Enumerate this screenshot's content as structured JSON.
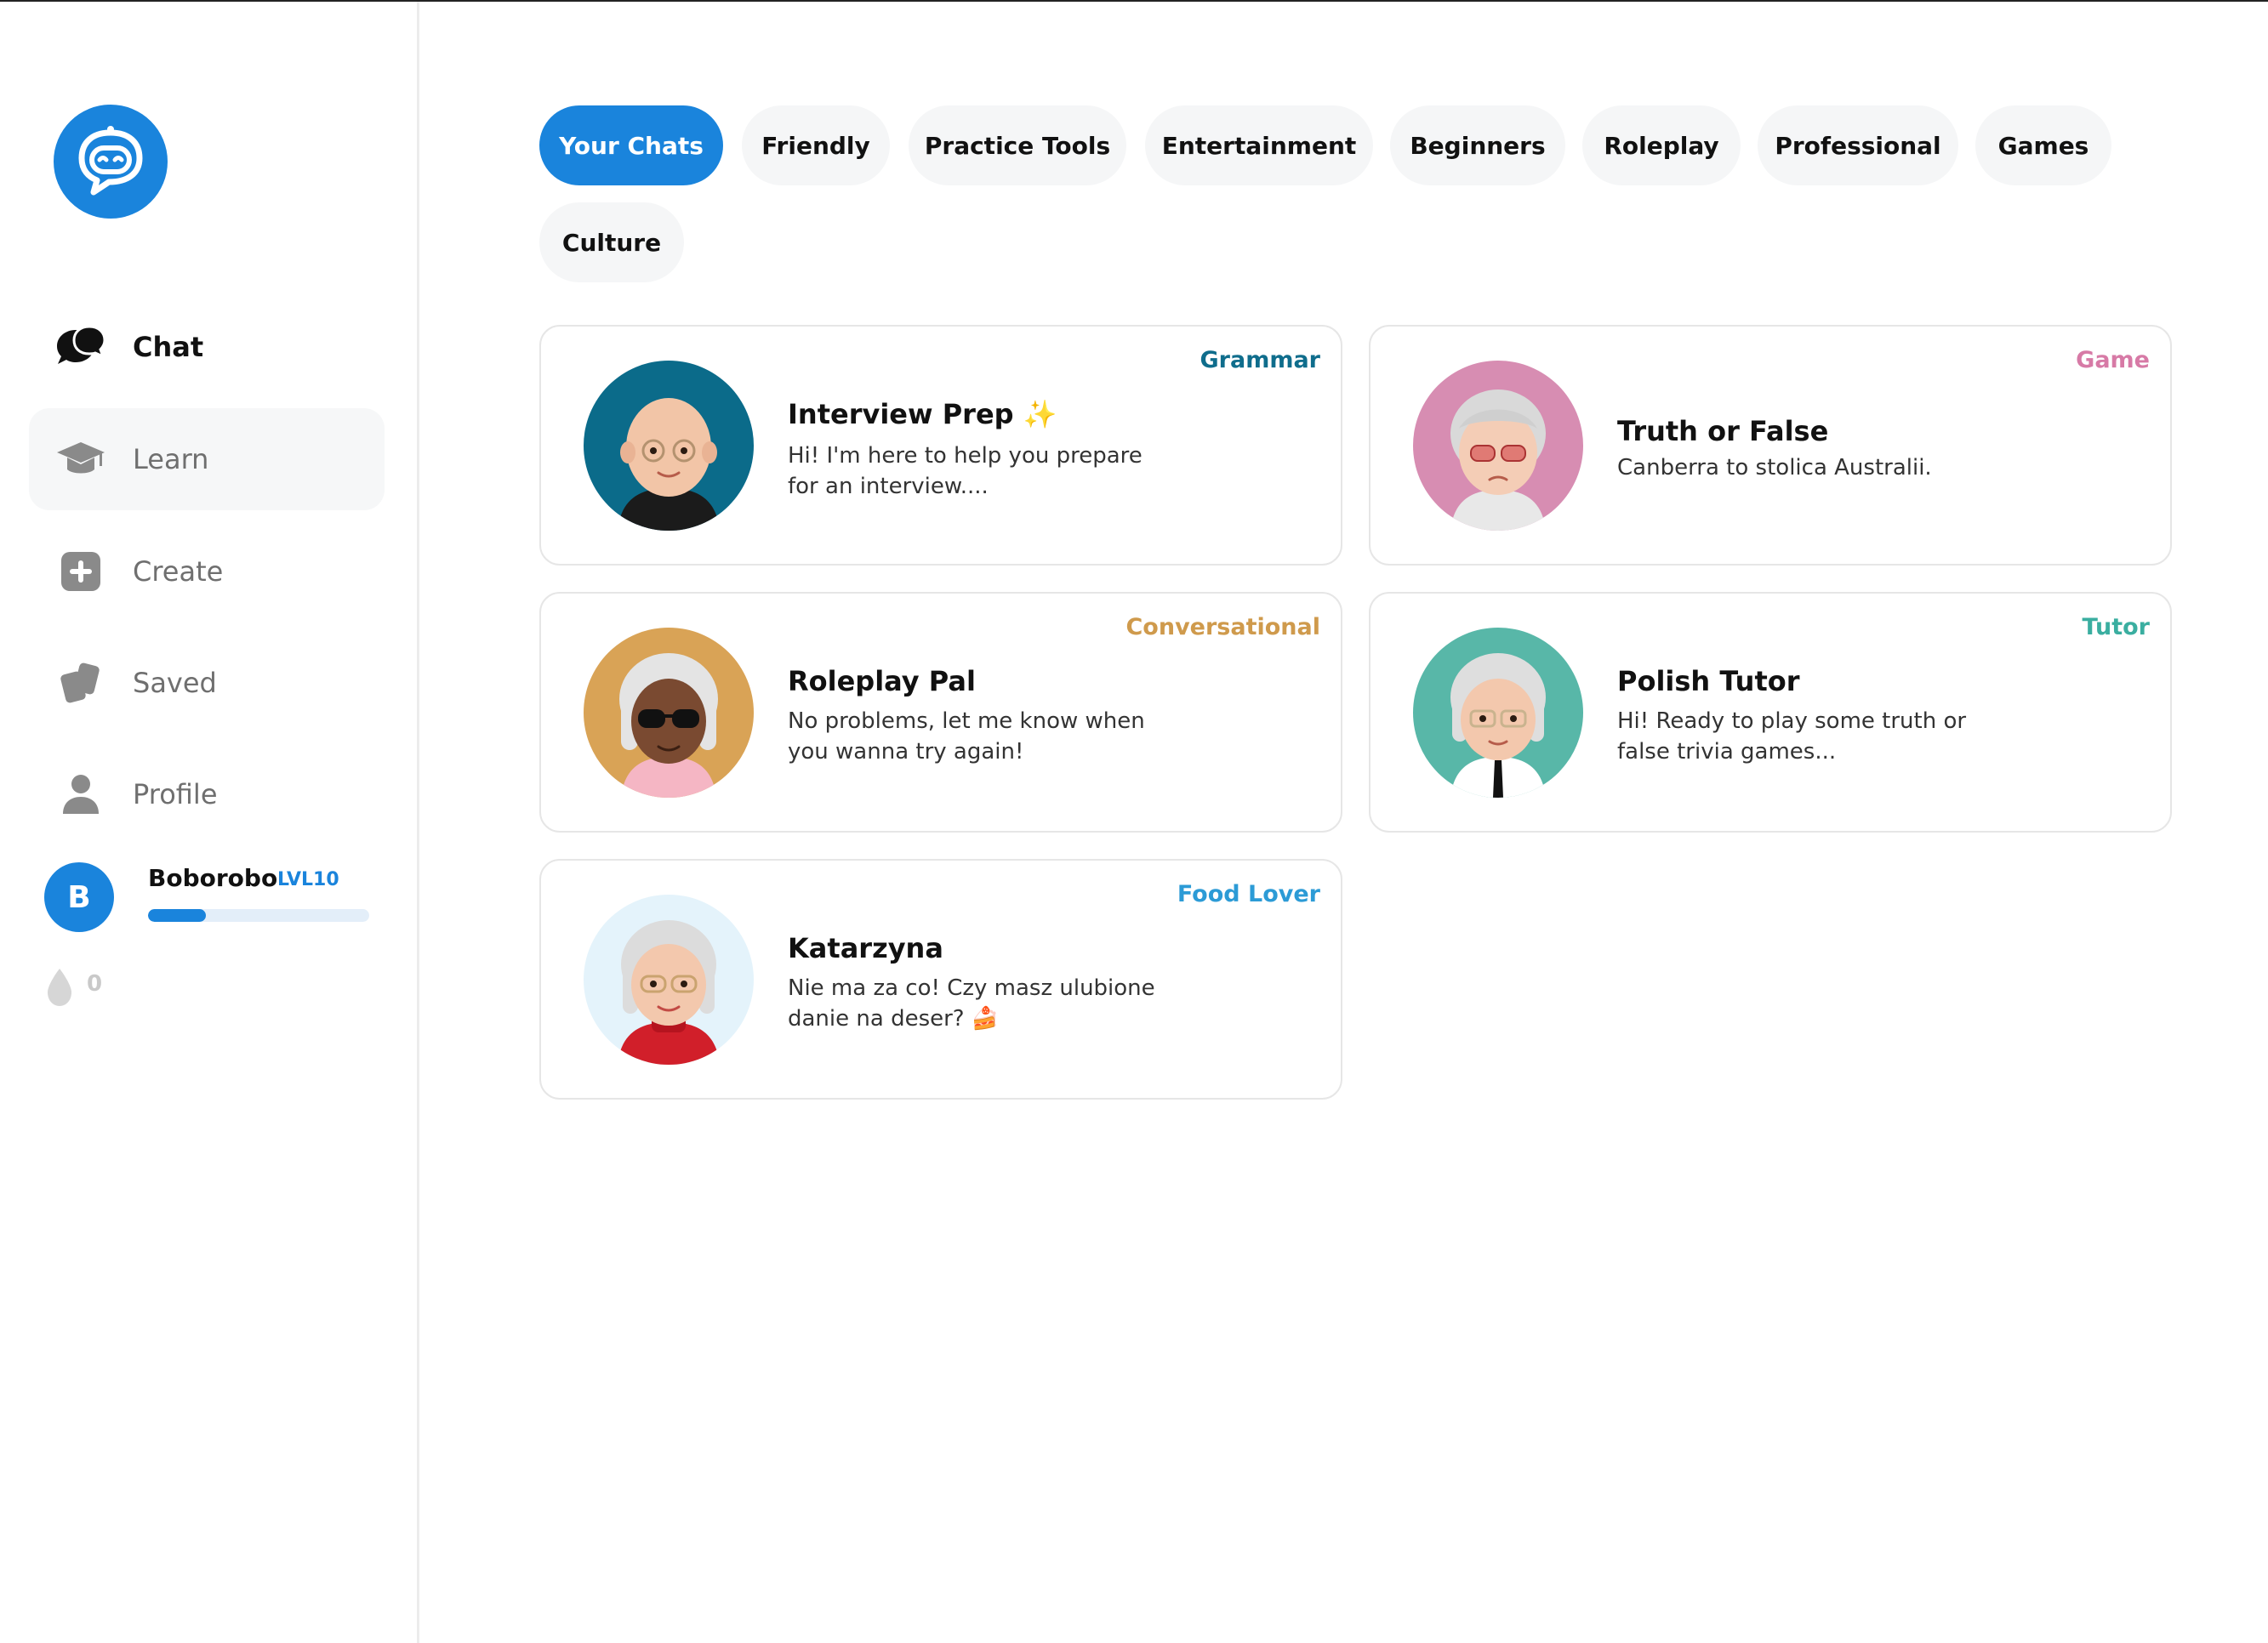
{
  "nav": {
    "items": [
      {
        "label": "Chat",
        "icon": "chat-bubbles-icon"
      },
      {
        "label": "Learn",
        "icon": "graduation-cap-icon"
      },
      {
        "label": "Create",
        "icon": "plus-square-icon"
      },
      {
        "label": "Saved",
        "icon": "cards-icon"
      },
      {
        "label": "Profile",
        "icon": "person-icon"
      }
    ]
  },
  "user": {
    "initial": "B",
    "name": "Boborobo",
    "level": "LVL10",
    "xp_progress": 0.26,
    "drops": "0"
  },
  "tabs": [
    "Your Chats",
    "Friendly",
    "Practice Tools",
    "Entertainment",
    "Beginners",
    "Roleplay",
    "Professional",
    "Games",
    "Culture"
  ],
  "cards": [
    {
      "title": "Interview Prep ✨",
      "description": "Hi! I'm here to help you prepare for an interview....",
      "tag": "Grammar",
      "tag_color": "#0f6d8c",
      "avatar_bg": "#0b6b8a"
    },
    {
      "title": "Truth or False",
      "description": "Canberra to stolica Australii.",
      "tag": "Game",
      "tag_color": "#d77aa6",
      "avatar_bg": "#d78db2"
    },
    {
      "title": "Roleplay Pal",
      "description": "No problems, let me know when you wanna try again!",
      "tag": "Conversational",
      "tag_color": "#cf9a4c",
      "avatar_bg": "#d9a356"
    },
    {
      "title": "Polish Tutor",
      "description": "Hi! Ready to play some truth or false trivia games...",
      "tag": "Tutor",
      "tag_color": "#3aaea0",
      "avatar_bg": "#58b7a8"
    },
    {
      "title": "Katarzyna",
      "description": "Nie ma za co! Czy masz ulubione danie na deser? 🍰",
      "tag": "Food Lover",
      "tag_color": "#2c9bd6",
      "avatar_bg": "#e4f3fb"
    }
  ],
  "colors": {
    "accent": "#1a84dc",
    "tab_bg": "#f5f6f7",
    "border": "#e6e6e6"
  }
}
